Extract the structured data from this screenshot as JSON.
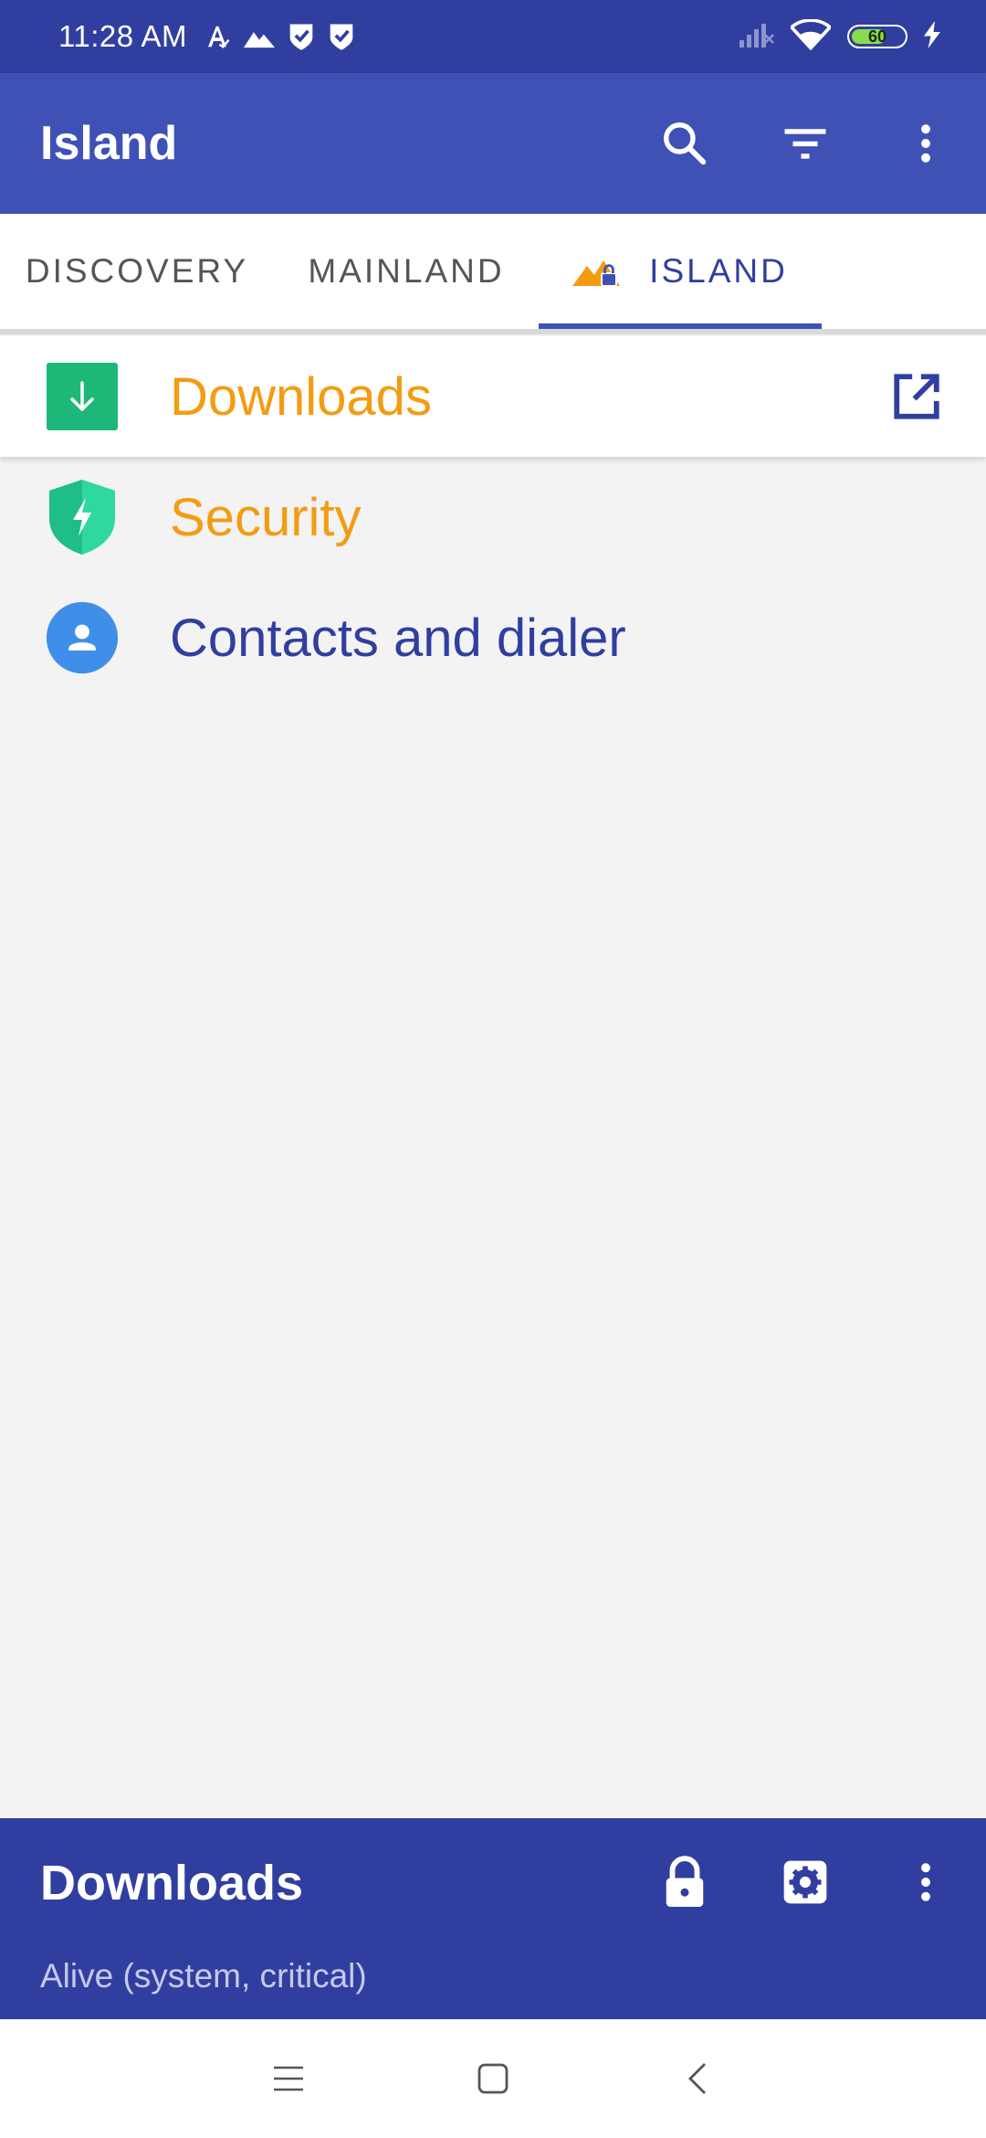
{
  "status_bar": {
    "time": "11:28 AM",
    "battery_level": "60",
    "icons": [
      "a-icon",
      "island-icon",
      "shield-check-icon",
      "shield-check-icon",
      "signal-icon",
      "wifi-icon",
      "battery-icon",
      "charging-icon"
    ]
  },
  "app_bar": {
    "title": "Island",
    "actions": [
      "search-icon",
      "filter-icon",
      "more-vert-icon"
    ]
  },
  "tabs": [
    {
      "label": "DISCOVERY",
      "selected": false
    },
    {
      "label": "MAINLAND",
      "selected": false
    },
    {
      "label": "ISLAND",
      "selected": true
    }
  ],
  "apps": [
    {
      "label": "Downloads",
      "icon": "download-icon",
      "color": "#f39c12",
      "selected": true
    },
    {
      "label": "Security",
      "icon": "security-shield-icon",
      "color": "#f39c12",
      "selected": false
    },
    {
      "label": "Contacts and dialer",
      "icon": "contacts-icon",
      "color": "#303f9f",
      "selected": false
    }
  ],
  "bottom_sheet": {
    "title": "Downloads",
    "subtitle": "Alive (system, critical)",
    "actions": [
      "lock-icon",
      "settings-icon",
      "more-vert-icon"
    ]
  },
  "colors": {
    "primary": "#3f51b5",
    "primary_dark": "#303f9f",
    "accent": "#f39c12",
    "background": "#f3f3f4"
  }
}
